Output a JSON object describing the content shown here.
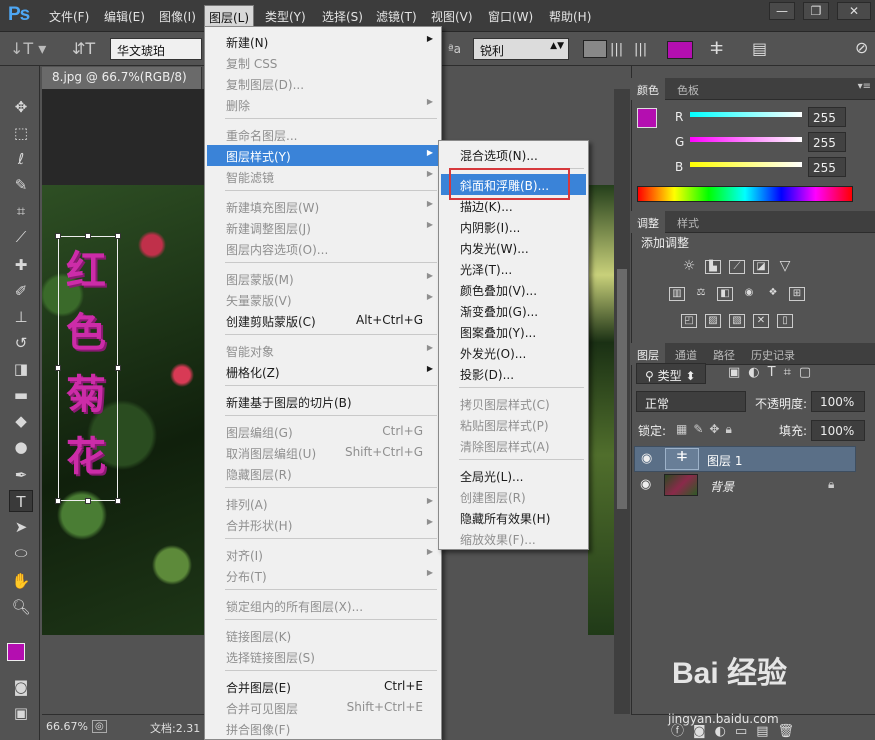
{
  "app": {
    "logo": "Ps",
    "window_controls": [
      "—",
      "❐",
      "✕"
    ]
  },
  "menubar": [
    "文件(F)",
    "编辑(E)",
    "图像(I)",
    "图层(L)",
    "类型(Y)",
    "选择(S)",
    "滤镜(T)",
    "视图(V)",
    "窗口(W)",
    "帮助(H)"
  ],
  "options": {
    "font": "华文琥珀",
    "aa_label": "ªa",
    "aa_value": "锐利",
    "color": "#b40eb0"
  },
  "doc": {
    "tab": "8.jpg @ 66.7%(RGB/8)",
    "text": "红色菊花",
    "zoom": "66.67%",
    "status": "文档:2.31"
  },
  "color_panel": {
    "tabs": [
      "颜色",
      "色板"
    ],
    "fg": "#b40eb0",
    "bg": "#ffffff",
    "channels": [
      {
        "name": "R",
        "value": "255"
      },
      {
        "name": "G",
        "value": "255"
      },
      {
        "name": "B",
        "value": "255"
      }
    ]
  },
  "adjust_panel": {
    "tabs": [
      "调整",
      "样式"
    ],
    "title": "添加调整"
  },
  "layers_panel": {
    "tabs": [
      "图层",
      "通道",
      "路径",
      "历史记录"
    ],
    "filter": "类型",
    "blend": "正常",
    "opacity_label": "不透明度:",
    "opacity": "100%",
    "lock_label": "锁定:",
    "fill_label": "填充:",
    "fill": "100%",
    "layers": [
      {
        "name": "图层 1",
        "selected": true
      },
      {
        "name": "背景",
        "selected": false
      }
    ]
  },
  "layer_menu": [
    {
      "label": "新建(N)",
      "arrow": true
    },
    {
      "label": "复制 CSS",
      "dis": true
    },
    {
      "label": "复制图层(D)...",
      "dis": true
    },
    {
      "label": "删除",
      "dis": true,
      "arrow": true
    },
    {
      "sep": true
    },
    {
      "label": "重命名图层...",
      "dis": true
    },
    {
      "label": "图层样式(Y)",
      "arrow": true,
      "sel": true
    },
    {
      "label": "智能滤镜",
      "dis": true,
      "arrow": true
    },
    {
      "sep": true
    },
    {
      "label": "新建填充图层(W)",
      "dis": true,
      "arrow": true
    },
    {
      "label": "新建调整图层(J)",
      "dis": true,
      "arrow": true
    },
    {
      "label": "图层内容选项(O)...",
      "dis": true
    },
    {
      "sep": true
    },
    {
      "label": "图层蒙版(M)",
      "dis": true,
      "arrow": true
    },
    {
      "label": "矢量蒙版(V)",
      "dis": true,
      "arrow": true
    },
    {
      "label": "创建剪贴蒙版(C)",
      "sc": "Alt+Ctrl+G"
    },
    {
      "sep": true
    },
    {
      "label": "智能对象",
      "dis": true,
      "arrow": true
    },
    {
      "label": "栅格化(Z)",
      "arrow": true
    },
    {
      "sep": true
    },
    {
      "label": "新建基于图层的切片(B)"
    },
    {
      "sep": true
    },
    {
      "label": "图层编组(G)",
      "dis": true,
      "sc": "Ctrl+G"
    },
    {
      "label": "取消图层编组(U)",
      "dis": true,
      "sc": "Shift+Ctrl+G"
    },
    {
      "label": "隐藏图层(R)",
      "dis": true
    },
    {
      "sep": true
    },
    {
      "label": "排列(A)",
      "dis": true,
      "arrow": true
    },
    {
      "label": "合并形状(H)",
      "dis": true,
      "arrow": true
    },
    {
      "sep": true
    },
    {
      "label": "对齐(I)",
      "dis": true,
      "arrow": true
    },
    {
      "label": "分布(T)",
      "dis": true,
      "arrow": true
    },
    {
      "sep": true
    },
    {
      "label": "锁定组内的所有图层(X)...",
      "dis": true
    },
    {
      "sep": true
    },
    {
      "label": "链接图层(K)",
      "dis": true
    },
    {
      "label": "选择链接图层(S)",
      "dis": true
    },
    {
      "sep": true
    },
    {
      "label": "合并图层(E)",
      "sc": "Ctrl+E"
    },
    {
      "label": "合并可见图层",
      "dis": true,
      "sc": "Shift+Ctrl+E"
    },
    {
      "label": "拼合图像(F)",
      "dis": true
    }
  ],
  "style_menu": [
    {
      "label": "混合选项(N)..."
    },
    {
      "sep": true
    },
    {
      "label": "斜面和浮雕(B)...",
      "sel": true
    },
    {
      "label": "描边(K)..."
    },
    {
      "label": "内阴影(I)..."
    },
    {
      "label": "内发光(W)..."
    },
    {
      "label": "光泽(T)..."
    },
    {
      "label": "颜色叠加(V)..."
    },
    {
      "label": "渐变叠加(G)..."
    },
    {
      "label": "图案叠加(Y)..."
    },
    {
      "label": "外发光(O)..."
    },
    {
      "label": "投影(D)..."
    },
    {
      "sep": true
    },
    {
      "label": "拷贝图层样式(C)",
      "dis": true
    },
    {
      "label": "粘贴图层样式(P)",
      "dis": true
    },
    {
      "label": "清除图层样式(A)",
      "dis": true
    },
    {
      "sep": true
    },
    {
      "label": "全局光(L)..."
    },
    {
      "label": "创建图层(R)",
      "dis": true
    },
    {
      "label": "隐藏所有效果(H)"
    },
    {
      "label": "缩放效果(F)...",
      "dis": true
    }
  ],
  "watermark": {
    "main": "Bai 经验",
    "sub": "jingyan.baidu.com"
  }
}
